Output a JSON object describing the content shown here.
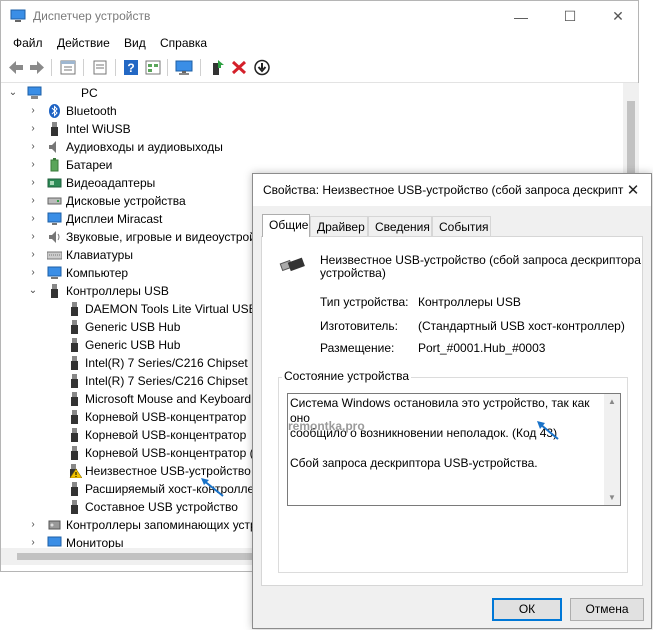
{
  "window": {
    "title": "Диспетчер устройств",
    "controls": [
      "minimize-icon",
      "maximize-icon",
      "close-icon"
    ]
  },
  "menu": [
    "Файл",
    "Действие",
    "Вид",
    "Справка"
  ],
  "toolbar": {
    "icons": [
      "back-arrow-icon",
      "forward-arrow-icon",
      "properties-icon",
      "properties-alt-icon",
      "help-icon",
      "view-icon",
      "monitor-icon",
      "update-driver-icon",
      "uninstall-icon",
      "download-icon"
    ]
  },
  "tree": {
    "root": "PC",
    "categories": [
      "Bluetooth",
      "Intel WiUSB",
      "Аудиовходы и аудиовыходы",
      "Батареи",
      "Видеоадаптеры",
      "Дисковые устройства",
      "Дисплеи Miracast",
      "Звуковые, игровые и видеоустрой",
      "Клавиатуры",
      "Компьютер",
      "Контроллеры USB"
    ],
    "usb_children": [
      "DAEMON Tools Lite Virtual USB",
      "Generic USB Hub",
      "Generic USB Hub",
      "Intel(R) 7 Series/C216 Chipset Fa",
      "Intel(R) 7 Series/C216 Chipset Fa",
      "Microsoft Mouse and Keyboard",
      "Корневой USB-концентратор",
      "Корневой USB-концентратор",
      "Корневой USB-концентратор (US",
      "Неизвестное USB-устройство (",
      "Расширяемый хост-контролле",
      "Составное USB устройство"
    ],
    "after": [
      "Контроллеры запоминающих устр",
      "Мониторы"
    ]
  },
  "dialog": {
    "title": "Свойства: Неизвестное USB-устройство (сбой запроса дескрипт",
    "tabs": [
      "Общие",
      "Драйвер",
      "Сведения",
      "События"
    ],
    "device_name_line1": "Неизвестное USB-устройство (сбой запроса дескриптора",
    "device_name_line2": "устройства)",
    "fields": [
      {
        "label": "Тип устройства:",
        "value": "Контроллеры USB"
      },
      {
        "label": "Изготовитель:",
        "value": "(Стандартный USB хост-контроллер)"
      },
      {
        "label": "Размещение:",
        "value": "Port_#0001.Hub_#0003"
      }
    ],
    "status_group_label": "Состояние устройства",
    "status_line1": "Система Windows остановила это устройство, так как оно",
    "status_line2": "сообщило о возникновении неполадок. (Код 43)",
    "status_line3": "Сбой запроса дескриптора USB-устройства.",
    "watermark": "remontka.pro",
    "ok": "ОК",
    "cancel": "Отмена"
  },
  "colors": {
    "accent": "#0078d7",
    "arrow": "#1a73c9",
    "warning": "#f2c200"
  }
}
